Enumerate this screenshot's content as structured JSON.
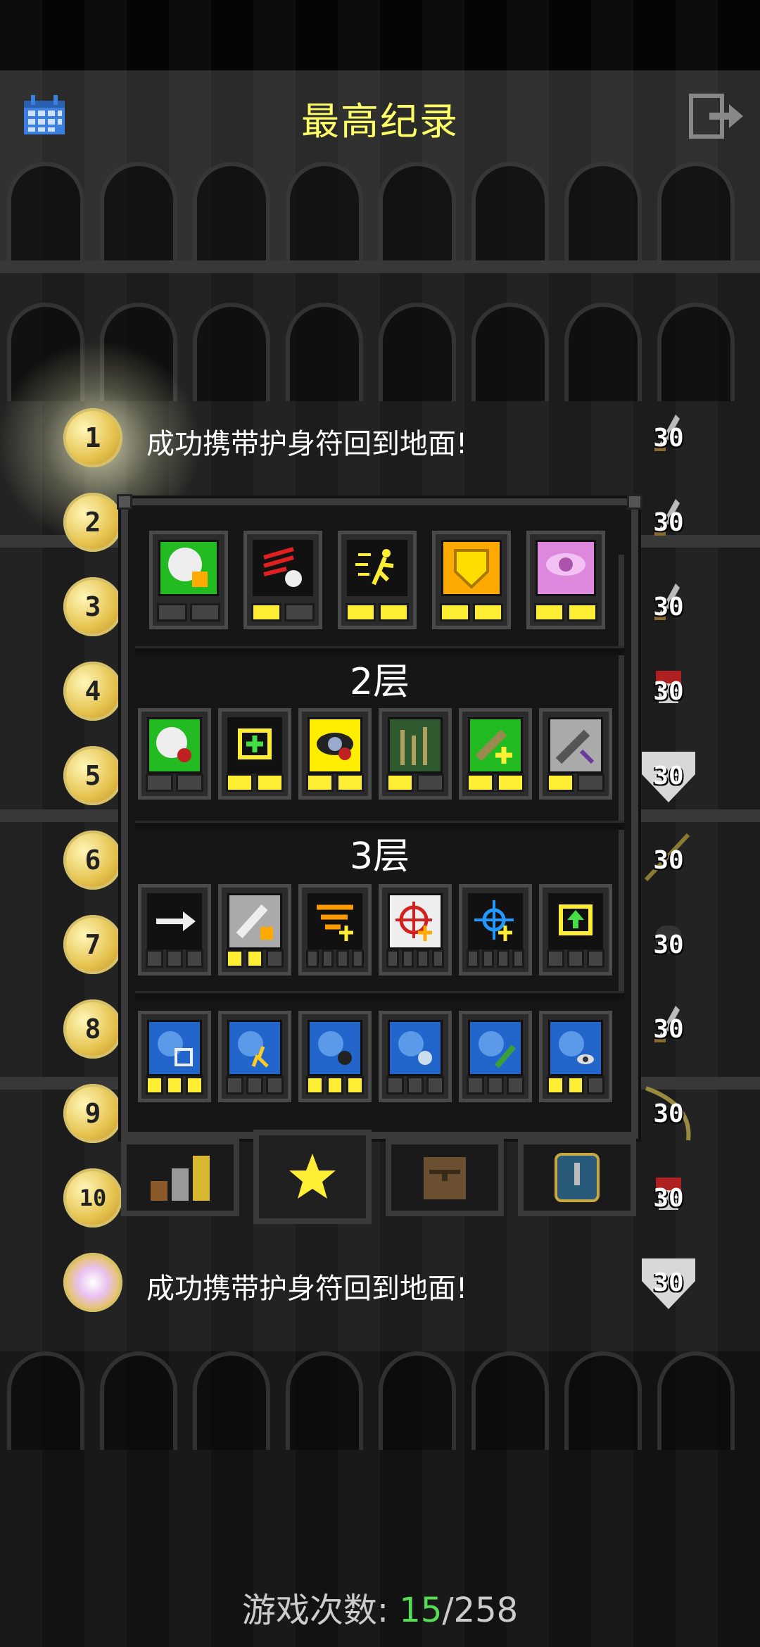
{
  "header": {
    "title": "最高纪录",
    "calendar_icon": "calendar-icon",
    "exit_icon": "exit-icon"
  },
  "rankings": [
    {
      "rank": "1",
      "text": "成功携带护身符回到地面!",
      "score": "30",
      "icon": "amulet-badge-icon"
    },
    {
      "rank": "2",
      "text": "",
      "score": "30",
      "icon": "dagger-icon"
    },
    {
      "rank": "3",
      "text": "",
      "score": "30",
      "icon": "dagger-icon"
    },
    {
      "rank": "4",
      "text": "",
      "score": "30",
      "icon": "red-helmet-icon"
    },
    {
      "rank": "5",
      "text": "",
      "score": "30",
      "icon": "white-shield-icon"
    },
    {
      "rank": "6",
      "text": "",
      "score": "30",
      "icon": "bow-icon"
    },
    {
      "rank": "7",
      "text": "",
      "score": "30",
      "icon": "black-helmet-icon"
    },
    {
      "rank": "8",
      "text": "",
      "score": "30",
      "icon": "dagger-icon"
    },
    {
      "rank": "9",
      "text": "",
      "score": "30",
      "icon": "bow-icon"
    },
    {
      "rank": "10",
      "text": "",
      "score": "30",
      "icon": "red-helmet-icon"
    }
  ],
  "last_entry": {
    "text": "成功携带护身符回到地面!",
    "score": "30",
    "icon": "white-shield-icon"
  },
  "talents_panel": {
    "tier1": [
      {
        "name": "clock-gear-icon",
        "color": "#22bb22",
        "pips": [
          0,
          0
        ]
      },
      {
        "name": "skull-slash-icon",
        "color": "#111111",
        "pips": [
          1,
          0
        ]
      },
      {
        "name": "runner-icon",
        "color": "#111111",
        "pips": [
          1,
          1
        ]
      },
      {
        "name": "shield-icon",
        "color": "#ffaa00",
        "pips": [
          1,
          1
        ]
      },
      {
        "name": "pink-eye-icon",
        "color": "#dd88dd",
        "pips": [
          1,
          1
        ]
      }
    ],
    "tier2_label": "2层",
    "tier2": [
      {
        "name": "clock-heal-icon",
        "color": "#22bb22",
        "pips": [
          0,
          0
        ]
      },
      {
        "name": "scroll-plus-icon",
        "color": "#111111",
        "pips": [
          1,
          1
        ]
      },
      {
        "name": "yellow-eye-icon",
        "color": "#ffee00",
        "pips": [
          1,
          1
        ]
      },
      {
        "name": "forest-icon",
        "color": "#2f5a2f",
        "pips": [
          1,
          0
        ]
      },
      {
        "name": "wand-plus-icon",
        "color": "#22bb22",
        "pips": [
          1,
          1
        ]
      },
      {
        "name": "gray-wand-icon",
        "color": "#aaaaaa",
        "pips": [
          1,
          0
        ]
      }
    ],
    "tier3_label": "3层",
    "tier3": [
      {
        "name": "arrow-icon",
        "color": "#111111",
        "pips": [
          0,
          0,
          0
        ]
      },
      {
        "name": "white-wand-gear-icon",
        "color": "#aaaaaa",
        "pips": [
          1,
          1,
          0
        ]
      },
      {
        "name": "orange-stripes-icon",
        "color": "#111111",
        "pips": [
          0,
          0,
          0,
          0
        ]
      },
      {
        "name": "target-red-icon",
        "color": "#eeeeee",
        "pips": [
          0,
          0,
          0,
          0
        ]
      },
      {
        "name": "target-blue-icon",
        "color": "#111111",
        "pips": [
          0,
          0,
          0,
          0
        ]
      },
      {
        "name": "scroll-up-icon",
        "color": "#111111",
        "pips": [
          0,
          0,
          0
        ]
      }
    ],
    "tier4": [
      {
        "name": "blue-head-maze-icon",
        "color": "#2266cc",
        "pips": [
          1,
          1,
          1
        ]
      },
      {
        "name": "blue-head-runner-icon",
        "color": "#2266cc",
        "pips": [
          0,
          0,
          0
        ]
      },
      {
        "name": "blue-head-dark-icon",
        "color": "#2266cc",
        "pips": [
          1,
          1,
          1
        ]
      },
      {
        "name": "blue-head-ghost-icon",
        "color": "#2266cc",
        "pips": [
          0,
          0,
          0
        ]
      },
      {
        "name": "blue-head-wand-icon",
        "color": "#2266cc",
        "pips": [
          0,
          0,
          0
        ]
      },
      {
        "name": "blue-head-eye-icon",
        "color": "#2266cc",
        "pips": [
          1,
          1,
          0
        ]
      }
    ]
  },
  "tabs": [
    {
      "name": "stats-tab",
      "icon": "bar-chart-icon"
    },
    {
      "name": "talents-tab",
      "icon": "star-icon"
    },
    {
      "name": "items-tab",
      "icon": "backpack-icon"
    },
    {
      "name": "badges-tab",
      "icon": "badge-icon"
    }
  ],
  "footer": {
    "games_label": "游戏次数: ",
    "games_current": "15",
    "games_sep": "/",
    "games_total": "258"
  },
  "colors": {
    "title": "#ffff66",
    "games_current": "#55dd55"
  }
}
